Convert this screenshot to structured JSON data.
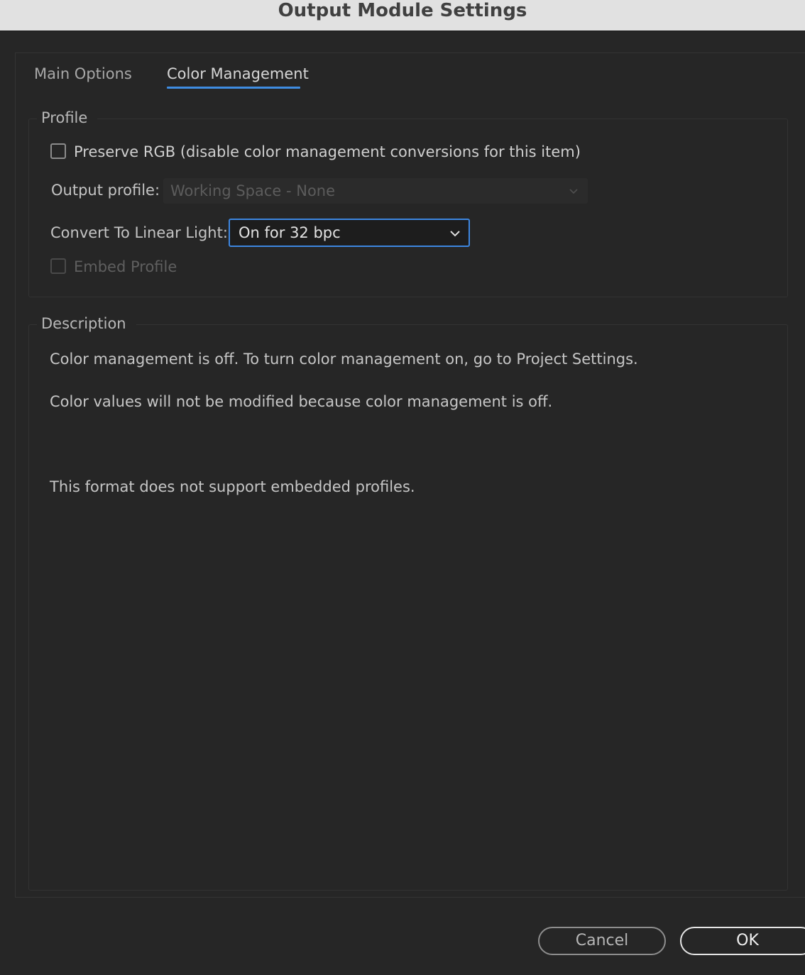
{
  "window": {
    "title": "Output Module Settings"
  },
  "tabs": [
    {
      "label": "Main Options",
      "active": false
    },
    {
      "label": "Color Management",
      "active": true
    }
  ],
  "profile": {
    "group_label": "Profile",
    "preserve_rgb": {
      "label": "Preserve RGB (disable color management conversions for this item)",
      "checked": false
    },
    "output_profile": {
      "label": "Output profile:",
      "value": "Working Space - None",
      "enabled": false
    },
    "linear_light": {
      "label": "Convert To Linear Light:",
      "value": "On for 32 bpc"
    },
    "embed_profile": {
      "label": "Embed Profile",
      "checked": false,
      "enabled": false
    }
  },
  "description": {
    "group_label": "Description",
    "lines": [
      "Color management is off. To turn color management on, go to Project Settings.",
      "Color values will not be modified because color management is off.",
      "This format does not support embedded profiles."
    ]
  },
  "buttons": {
    "cancel": "Cancel",
    "ok": "OK"
  },
  "colors": {
    "accent": "#3f8de2",
    "background": "#262626",
    "titlebar": "#e1e1e1"
  }
}
